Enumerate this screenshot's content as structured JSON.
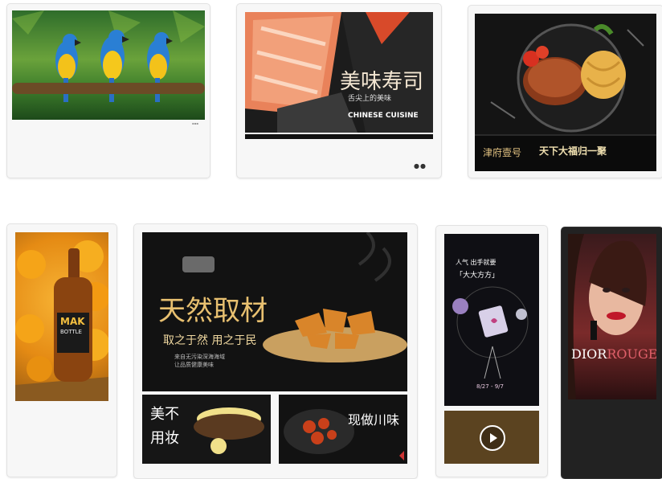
{
  "screens": {
    "parrots": {
      "brand": ""
    },
    "sushi": {
      "title": "美味寿司",
      "subtitle": "舌尖上的美味",
      "english": "CHINESE CUISINE"
    },
    "steak": {
      "logo": "津府壹号",
      "slogan": "天下大福归一聚"
    },
    "beer": {
      "bottle_label": "MAK",
      "bottle_sub": "BOTTLE"
    },
    "food_main": {
      "title": "天然取材",
      "subtitle": "取之于然 用之于民",
      "desc1": "来自无污染深海海域",
      "desc2": "让品质健康美味"
    },
    "makeup_panel": {
      "line1": "美不",
      "line2": "用妆"
    },
    "chuancai_panel": {
      "title": "现做川味"
    },
    "portrait_ad": {
      "title1": "人气 出手就要",
      "title2": "「大大方方」",
      "dates": "8/27 - 9/7"
    },
    "dior": {
      "brand": "DIOR",
      "brand_accent": "ROUGE"
    }
  }
}
